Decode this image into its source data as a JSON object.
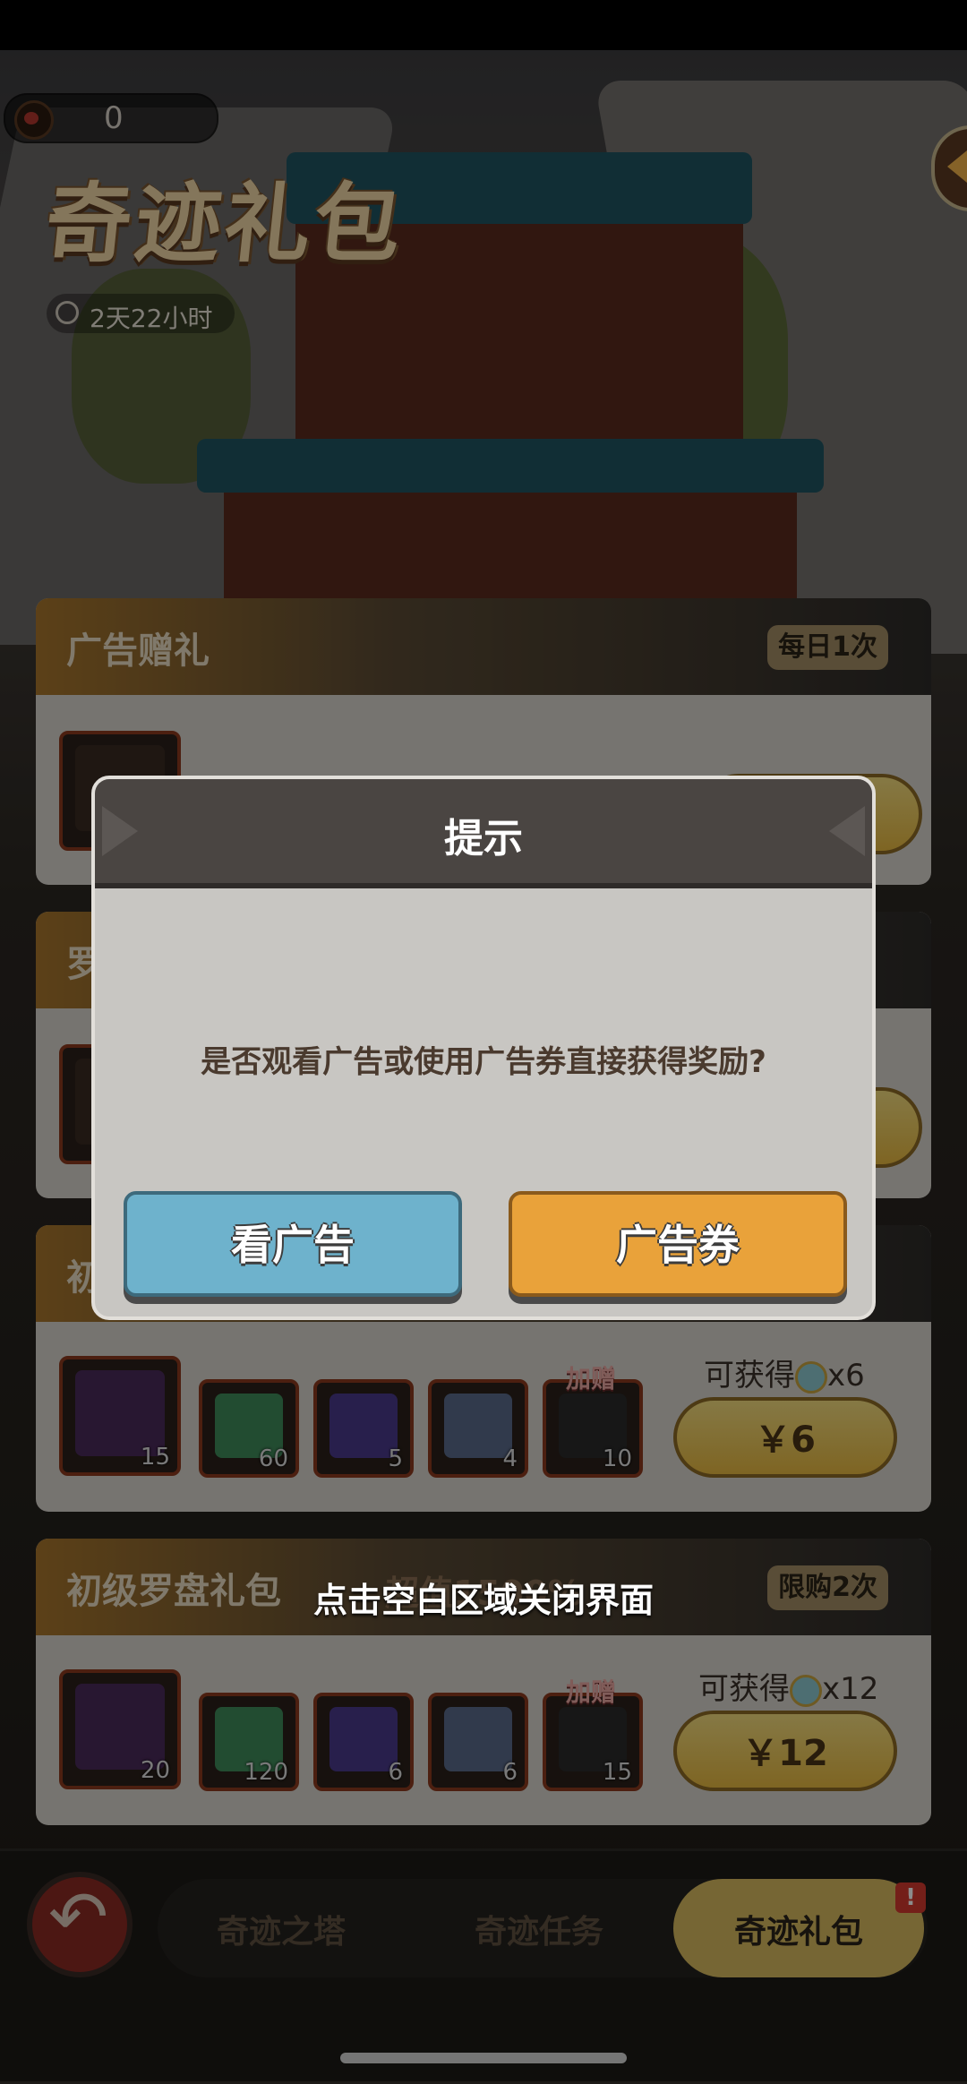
{
  "header": {
    "coin_count": "0",
    "page_title": "奇迹礼包",
    "timer": "2天22小时"
  },
  "panels": [
    {
      "title": "广告赠礼",
      "badge": "每日1次",
      "partial_title": "罗"
    },
    {
      "partial_title": "初"
    },
    {
      "reward_label": "可获得",
      "reward_count": "x6",
      "bonus_tag": "加赠",
      "price": "￥6",
      "items": [
        "15",
        "60",
        "5",
        "4",
        "10"
      ]
    },
    {
      "title": "初级罗盘礼包",
      "faded_tag": "超值1500%",
      "badge": "限购2次",
      "reward_label": "可获得",
      "reward_count": "x12",
      "bonus_tag": "加赠",
      "price": "￥12",
      "items": [
        "20",
        "120",
        "6",
        "6",
        "15"
      ]
    }
  ],
  "dialog": {
    "title": "提示",
    "message": "是否观看广告或使用广告券直接获得奖励?",
    "watch_ad_label": "看广告",
    "voucher_label": "广告券"
  },
  "close_hint": "点击空白区域关闭界面",
  "bottom_nav": {
    "tabs": [
      "奇迹之塔",
      "奇迹任务",
      "奇迹礼包"
    ],
    "active_tab": "奇迹礼包",
    "alert": "!"
  },
  "colors": {
    "accent_orange": "#e9a23a",
    "accent_blue": "#6eb2cc",
    "gold": "#d8bb5f"
  }
}
